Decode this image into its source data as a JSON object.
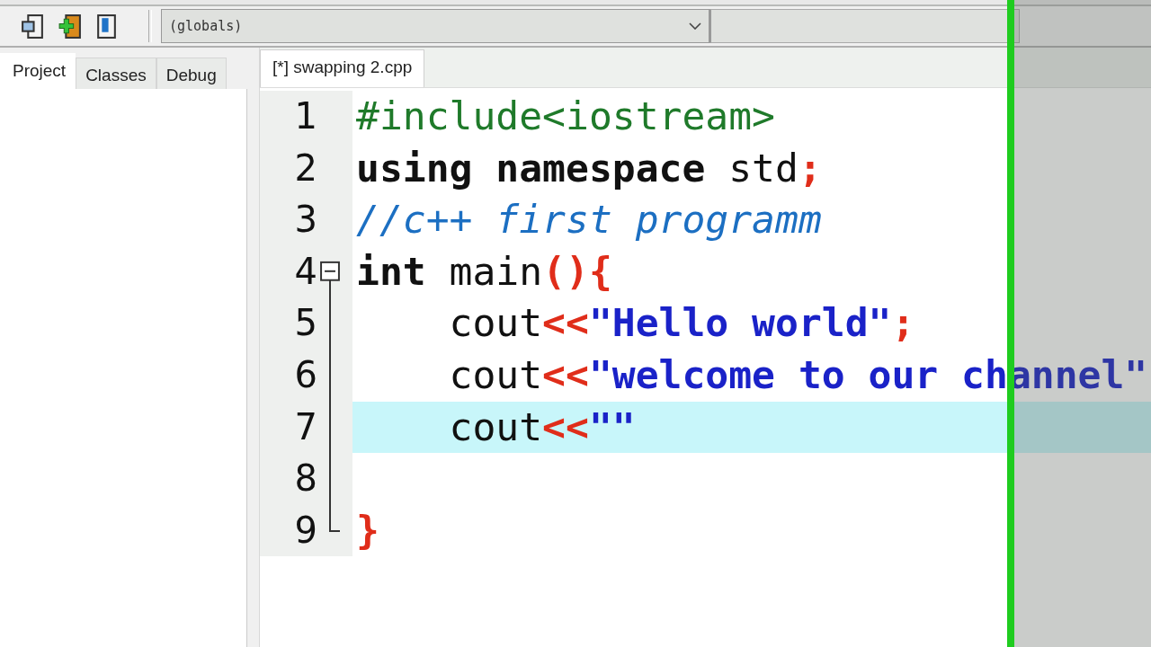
{
  "toolbar": {
    "scope_dropdown": {
      "value": "(globals)"
    }
  },
  "left_panel": {
    "tabs": [
      {
        "label": "Project",
        "selected": true
      },
      {
        "label": "Classes",
        "selected": false
      },
      {
        "label": "Debug",
        "selected": false
      }
    ]
  },
  "editor": {
    "tabs": [
      {
        "label": "[*] swapping 2.cpp",
        "selected": true
      }
    ],
    "lines": [
      {
        "number": "1",
        "current": false,
        "fold_start": false,
        "fold_end": false,
        "tokens": [
          {
            "kind": "preproc",
            "text": "#include<iostream>"
          }
        ]
      },
      {
        "number": "2",
        "current": false,
        "fold_start": false,
        "fold_end": false,
        "tokens": [
          {
            "kind": "keyword",
            "text": "using namespace"
          },
          {
            "kind": "plain",
            "text": " std"
          },
          {
            "kind": "operator",
            "text": ";"
          }
        ]
      },
      {
        "number": "3",
        "current": false,
        "fold_start": false,
        "fold_end": false,
        "tokens": [
          {
            "kind": "comment",
            "text": "//c++ first programm"
          }
        ]
      },
      {
        "number": "4",
        "current": false,
        "fold_start": true,
        "fold_end": false,
        "tokens": [
          {
            "kind": "keyword",
            "text": "int"
          },
          {
            "kind": "plain",
            "text": " main"
          },
          {
            "kind": "operator",
            "text": "(){"
          }
        ]
      },
      {
        "number": "5",
        "current": false,
        "fold_start": false,
        "fold_end": false,
        "tokens": [
          {
            "kind": "plain",
            "text": "    cout"
          },
          {
            "kind": "operator",
            "text": "<<"
          },
          {
            "kind": "string",
            "text": "\"Hello world\""
          },
          {
            "kind": "operator",
            "text": ";"
          }
        ]
      },
      {
        "number": "6",
        "current": false,
        "fold_start": false,
        "fold_end": false,
        "tokens": [
          {
            "kind": "plain",
            "text": "    cout"
          },
          {
            "kind": "operator",
            "text": "<<"
          },
          {
            "kind": "string",
            "text": "\"welcome to our channel\""
          }
        ]
      },
      {
        "number": "7",
        "current": true,
        "fold_start": false,
        "fold_end": false,
        "tokens": [
          {
            "kind": "plain",
            "text": "    cout"
          },
          {
            "kind": "operator",
            "text": "<<"
          },
          {
            "kind": "string",
            "text": "\"\""
          }
        ]
      },
      {
        "number": "8",
        "current": false,
        "fold_start": false,
        "fold_end": false
      },
      {
        "number": "9",
        "current": false,
        "fold_start": false,
        "fold_end": true,
        "tokens": [
          {
            "kind": "operator",
            "text": "}"
          }
        ]
      }
    ]
  }
}
